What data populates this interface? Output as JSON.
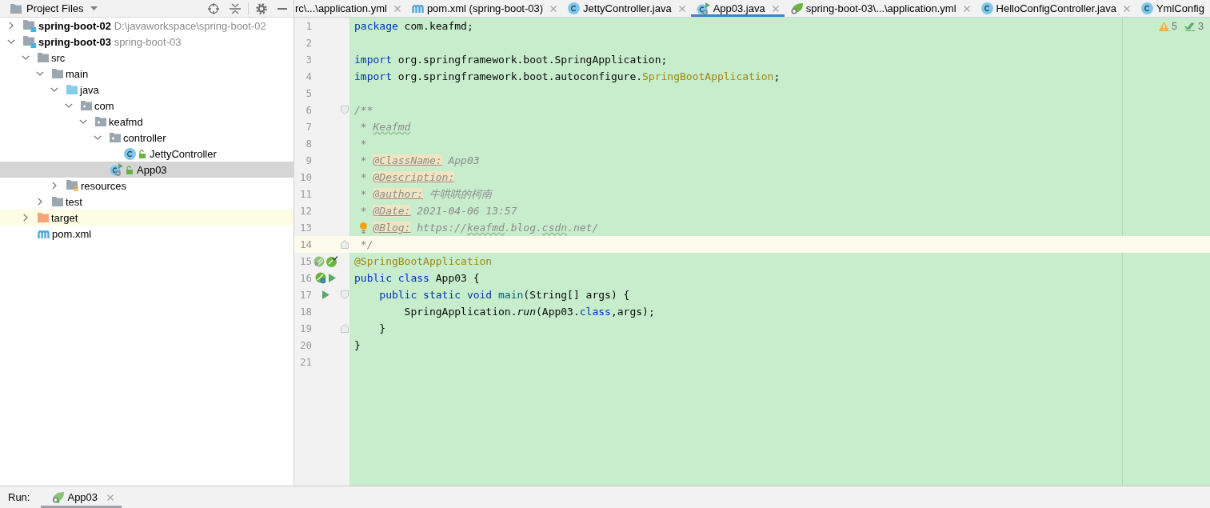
{
  "project_panel": {
    "title": "Project Files",
    "tree": [
      {
        "name": "spring-boot-02",
        "hint": "D:\\javaworkspace\\spring-boot-02",
        "kind": "module",
        "expanded": false,
        "selected": false
      },
      {
        "name": "spring-boot-03",
        "hint": "spring-boot-03",
        "kind": "module",
        "expanded": true,
        "selected": false,
        "children": [
          {
            "name": "src",
            "kind": "folder",
            "expanded": true,
            "selected": false,
            "children": [
              {
                "name": "main",
                "kind": "folder",
                "expanded": true,
                "selected": false,
                "children": [
                  {
                    "name": "java",
                    "kind": "source-root",
                    "expanded": true,
                    "selected": false,
                    "children": [
                      {
                        "name": "com",
                        "kind": "package",
                        "expanded": true,
                        "selected": false,
                        "children": [
                          {
                            "name": "keafmd",
                            "kind": "package",
                            "expanded": true,
                            "selected": false,
                            "children": [
                              {
                                "name": "controller",
                                "kind": "package",
                                "expanded": true,
                                "selected": false,
                                "children": [
                                  {
                                    "name": "JettyController",
                                    "kind": "class",
                                    "selected": false
                                  }
                                ]
                              },
                              {
                                "name": "App03",
                                "kind": "main-class",
                                "selected": true
                              }
                            ]
                          }
                        ]
                      }
                    ]
                  },
                  {
                    "name": "resources",
                    "kind": "resources-root",
                    "expanded": false,
                    "selected": false
                  }
                ]
              },
              {
                "name": "test",
                "kind": "folder",
                "expanded": false,
                "selected": false
              }
            ]
          },
          {
            "name": "target",
            "kind": "excluded-folder",
            "expanded": false,
            "selected": false
          },
          {
            "name": "pom.xml",
            "kind": "pom",
            "selected": false
          }
        ]
      }
    ]
  },
  "tabs": [
    {
      "label": "rc\\...\\application.yml",
      "selected": false,
      "closable": true
    },
    {
      "label": "pom.xml (spring-boot-03)",
      "kind": "pom",
      "selected": false,
      "closable": true
    },
    {
      "label": "JettyController.java",
      "kind": "class",
      "selected": false,
      "closable": true
    },
    {
      "label": "App03.java",
      "kind": "main-class",
      "selected": true,
      "closable": true
    },
    {
      "label": "spring-boot-03\\...\\application.yml",
      "kind": "config",
      "selected": false,
      "closable": true
    },
    {
      "label": "HelloConfigController.java",
      "kind": "class",
      "selected": false,
      "closable": true
    },
    {
      "label": "YmlConfig",
      "kind": "class",
      "selected": false,
      "closable": false
    }
  ],
  "editor": {
    "inspections": [
      {
        "kind": "warning",
        "count": "5"
      },
      {
        "kind": "checks",
        "count": "3"
      }
    ],
    "lines": [
      {
        "number": "1",
        "current": false,
        "tokens": [
          {
            "text": "package",
            "kind": "keyword"
          },
          {
            "text": " com.keafmd;",
            "kind": "plain"
          }
        ]
      },
      {
        "number": "2",
        "current": false
      },
      {
        "number": "3",
        "current": false,
        "tokens": [
          {
            "text": "import",
            "kind": "keyword"
          },
          {
            "text": " org.springframework.boot.SpringApplication;",
            "kind": "plain"
          }
        ]
      },
      {
        "number": "4",
        "current": false,
        "tokens": [
          {
            "text": "import",
            "kind": "keyword"
          },
          {
            "text": " org.springframework.boot.autoconfigure.",
            "kind": "plain"
          },
          {
            "text": "SpringBootApplication",
            "kind": "annotation"
          },
          {
            "text": ";",
            "kind": "plain"
          }
        ]
      },
      {
        "number": "5",
        "current": false
      },
      {
        "number": "6",
        "current": false,
        "fold": {
          "kind": "start"
        },
        "tokens": [
          {
            "text": "/**",
            "kind": "comment"
          }
        ]
      },
      {
        "number": "7",
        "current": false,
        "tokens": [
          {
            "text": " * ",
            "kind": "comment"
          },
          {
            "text": "Keafmd",
            "kind": "typo"
          }
        ]
      },
      {
        "number": "8",
        "current": false,
        "tokens": [
          {
            "text": " *",
            "kind": "comment"
          }
        ]
      },
      {
        "number": "9",
        "current": false,
        "tokens": [
          {
            "text": " * ",
            "kind": "comment"
          },
          {
            "text": "@ClassName:",
            "kind": "doctag"
          },
          {
            "text": " App03",
            "kind": "comment"
          }
        ]
      },
      {
        "number": "10",
        "current": false,
        "tokens": [
          {
            "text": " * ",
            "kind": "comment"
          },
          {
            "text": "@Description:",
            "kind": "doctag"
          }
        ]
      },
      {
        "number": "11",
        "current": false,
        "tokens": [
          {
            "text": " * ",
            "kind": "comment"
          },
          {
            "text": "@author:",
            "kind": "doctag"
          },
          {
            "text": " 牛哄哄的柯南",
            "kind": "comment"
          }
        ]
      },
      {
        "number": "12",
        "current": false,
        "tokens": [
          {
            "text": " * ",
            "kind": "comment"
          },
          {
            "text": "@Date:",
            "kind": "doctag"
          },
          {
            "text": " 2021-04-06 13:57",
            "kind": "comment"
          }
        ]
      },
      {
        "number": "13",
        "current": false,
        "tokens": [
          {
            "kind": "bulb"
          },
          {
            "text": "@Blog:",
            "kind": "doctag"
          },
          {
            "text": " https://",
            "kind": "comment"
          },
          {
            "text": "keafmd",
            "kind": "typo"
          },
          {
            "text": ".blog.",
            "kind": "comment"
          },
          {
            "text": "csdn",
            "kind": "typo"
          },
          {
            "text": ".net/",
            "kind": "comment"
          }
        ]
      },
      {
        "number": "14",
        "current": true,
        "fold": {
          "kind": "end"
        },
        "tokens": [
          {
            "text": " */",
            "kind": "comment"
          }
        ]
      },
      {
        "number": "15",
        "current": false,
        "gutter": [
          {
            "kind": "bean"
          },
          {
            "kind": "bean-navigate"
          }
        ],
        "tokens": [
          {
            "text": "@SpringBootApplication",
            "kind": "annotation"
          }
        ]
      },
      {
        "number": "16",
        "current": false,
        "gutter": [
          {
            "kind": "spring-boot"
          },
          {
            "kind": "run"
          }
        ],
        "tokens": [
          {
            "text": "public class",
            "kind": "keyword"
          },
          {
            "text": " App03 {",
            "kind": "plain"
          }
        ]
      },
      {
        "number": "17",
        "current": false,
        "gutter": [
          {
            "kind": "run"
          }
        ],
        "fold": {
          "kind": "start"
        },
        "tokens": [
          {
            "text": "    public static void",
            "kind": "keyword"
          },
          {
            "text": " main",
            "kind": "method-decl"
          },
          {
            "text": "(String[] args) {",
            "kind": "plain"
          }
        ]
      },
      {
        "number": "18",
        "current": false,
        "tokens": [
          {
            "text": "        SpringApplication.",
            "kind": "plain"
          },
          {
            "text": "run",
            "kind": "static-call"
          },
          {
            "text": "(App03.",
            "kind": "plain"
          },
          {
            "text": "class",
            "kind": "keyword"
          },
          {
            "text": ",args);",
            "kind": "plain"
          }
        ]
      },
      {
        "number": "19",
        "current": false,
        "fold": {
          "kind": "end"
        },
        "tokens": [
          {
            "text": "    }",
            "kind": "plain"
          }
        ]
      },
      {
        "number": "20",
        "current": false,
        "tokens": [
          {
            "text": "}",
            "kind": "plain"
          }
        ]
      },
      {
        "number": "21",
        "current": false
      }
    ]
  },
  "run_bar": {
    "label": "Run:",
    "tabs": [
      {
        "label": "App03",
        "selected": true
      }
    ]
  }
}
